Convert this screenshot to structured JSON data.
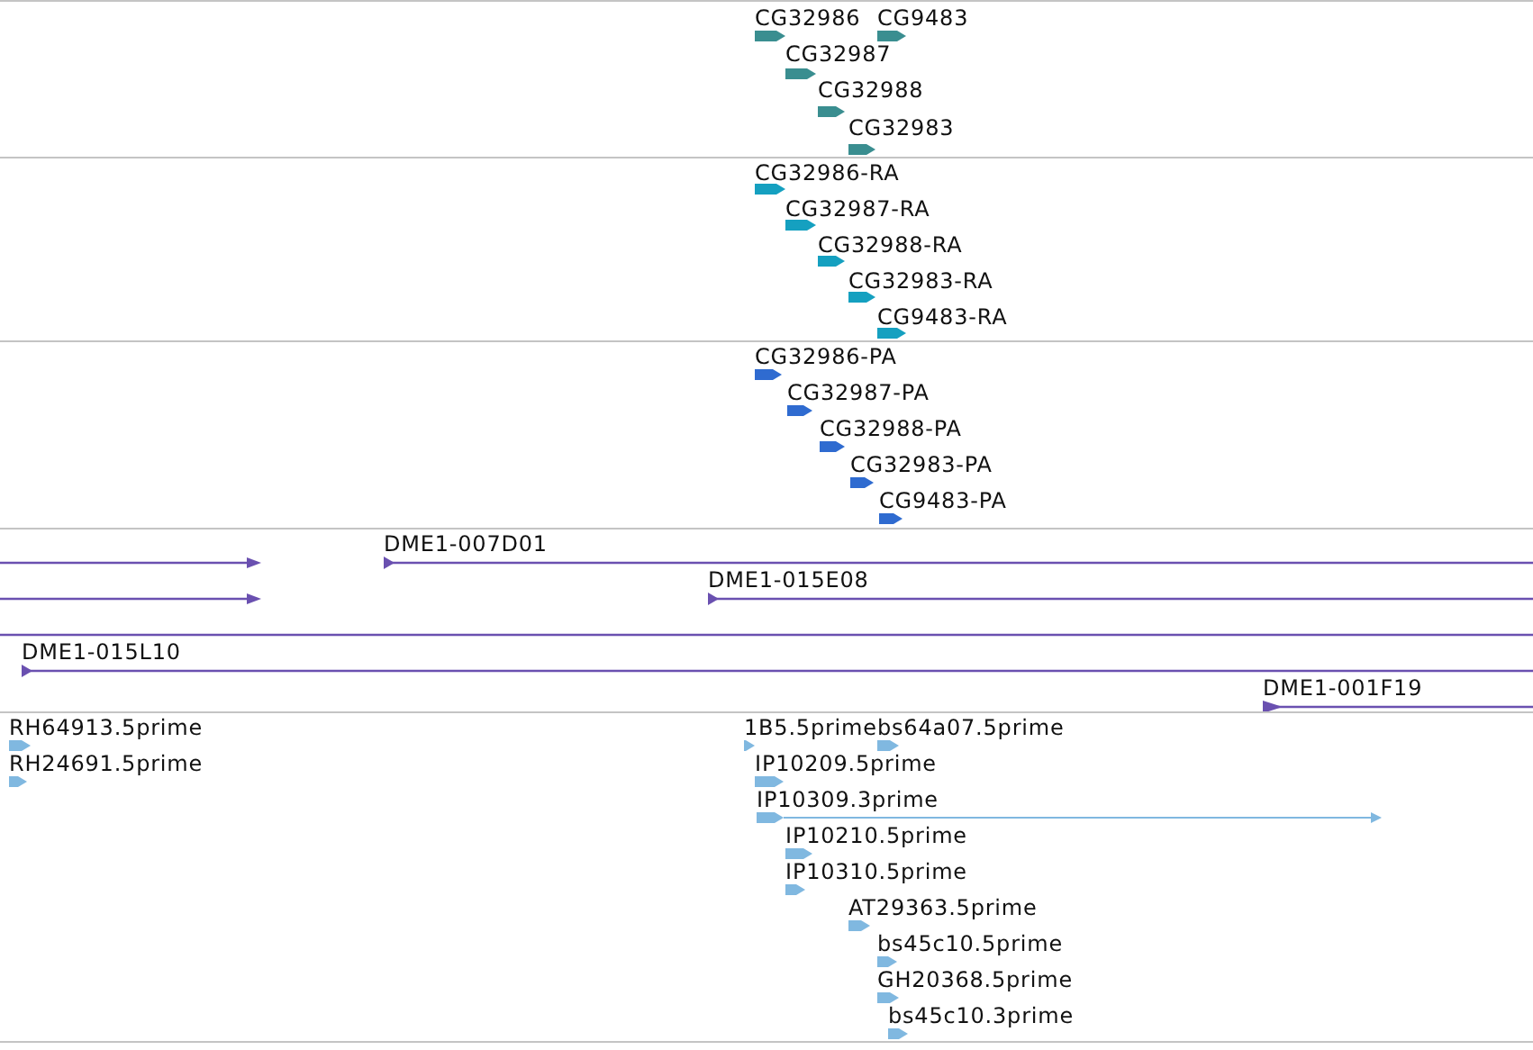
{
  "tracks": [
    {
      "color": "#3a8e90",
      "features": [
        {
          "kind": "block",
          "label": "CG32986"
        },
        {
          "kind": "block",
          "label": "CG9483"
        },
        {
          "kind": "block",
          "label": "CG32987"
        },
        {
          "kind": "block",
          "label": "CG32988"
        },
        {
          "kind": "block",
          "label": "CG32983"
        }
      ]
    },
    {
      "color": "#15a0c0",
      "features": [
        {
          "kind": "block",
          "label": "CG32986-RA"
        },
        {
          "kind": "block",
          "label": "CG32987-RA"
        },
        {
          "kind": "block",
          "label": "CG32988-RA"
        },
        {
          "kind": "block",
          "label": "CG32983-RA"
        },
        {
          "kind": "block",
          "label": "CG9483-RA"
        }
      ]
    },
    {
      "color": "#2f6bd0",
      "features": [
        {
          "kind": "block",
          "label": "CG32986-PA"
        },
        {
          "kind": "block",
          "label": "CG32987-PA"
        },
        {
          "kind": "block",
          "label": "CG32988-PA"
        },
        {
          "kind": "block",
          "label": "CG32983-PA"
        },
        {
          "kind": "block",
          "label": "CG9483-PA"
        }
      ]
    },
    {
      "color": "#6a50b0",
      "features": [
        {
          "kind": "line"
        },
        {
          "kind": "line",
          "label": "DME1-007D01"
        },
        {
          "kind": "line"
        },
        {
          "kind": "line",
          "label": "DME1-015E08"
        },
        {
          "kind": "line"
        },
        {
          "kind": "line",
          "label": "DME1-015L10"
        },
        {
          "kind": "line",
          "label": "DME1-001F19"
        }
      ]
    },
    {
      "color": "#80b8e0",
      "features": [
        {
          "kind": "block",
          "label": "RH64913.5prime"
        },
        {
          "kind": "block",
          "label": "RH24691.5prime"
        },
        {
          "kind": "block",
          "label": "1B5.5prime"
        },
        {
          "kind": "block",
          "label": "bs64a07.5prime"
        },
        {
          "kind": "block",
          "label": "IP10209.5prime"
        },
        {
          "kind": "block_line",
          "label": "IP10309.3prime"
        },
        {
          "kind": "block",
          "label": "IP10210.5prime"
        },
        {
          "kind": "block",
          "label": "IP10310.5prime"
        },
        {
          "kind": "block",
          "label": "AT29363.5prime"
        },
        {
          "kind": "block",
          "label": "bs45c10.5prime"
        },
        {
          "kind": "block",
          "label": "GH20368.5prime"
        },
        {
          "kind": "block",
          "label": "bs45c10.3prime"
        }
      ]
    }
  ]
}
